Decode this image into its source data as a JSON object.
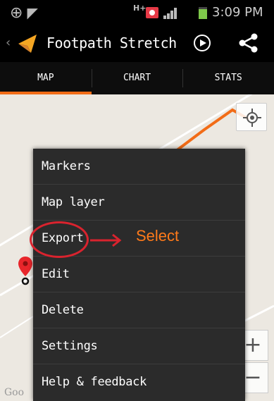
{
  "status_bar": {
    "network_label": "H+",
    "time": "3:09 PM",
    "icons": [
      "gps-icon",
      "navigation-icon",
      "notification-icon",
      "signal-icon",
      "battery-icon"
    ]
  },
  "action_bar": {
    "back_glyph": "‹",
    "title": "Footpath Stretch",
    "app_icon": "orange-arrow-icon",
    "actions": [
      "play-icon",
      "share-icon"
    ]
  },
  "tabs": [
    {
      "label": "MAP",
      "active": true
    },
    {
      "label": "CHART",
      "active": false
    },
    {
      "label": "STATS",
      "active": false
    }
  ],
  "map": {
    "zoom_in": "+",
    "zoom_out": "−",
    "attribution": "Goo",
    "route_color": "#f26c17"
  },
  "menu": {
    "items": [
      {
        "label": "Markers"
      },
      {
        "label": "Map layer"
      },
      {
        "label": "Export"
      },
      {
        "label": "Edit"
      },
      {
        "label": "Delete"
      },
      {
        "label": "Settings"
      },
      {
        "label": "Help & feedback"
      }
    ]
  },
  "annotation": {
    "text": "Select",
    "color": "#ff7a1a",
    "ring_color": "#d9232e"
  },
  "colors": {
    "accent": "#f26c17",
    "menu_bg": "#2b2b2b",
    "map_bg": "#ece8e1"
  }
}
